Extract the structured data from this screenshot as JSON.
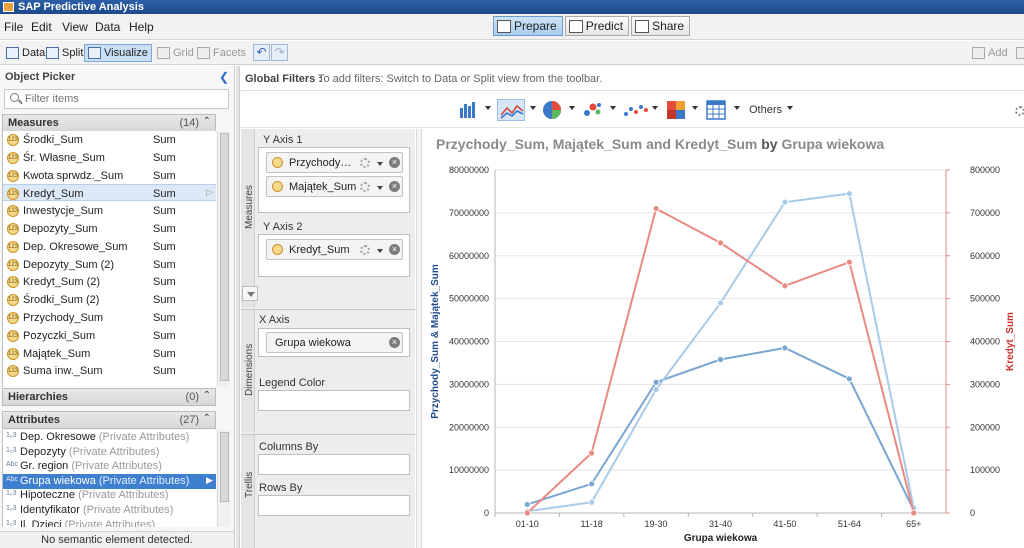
{
  "app": {
    "title": "SAP Predictive Analysis"
  },
  "menu": [
    "File",
    "Edit",
    "View",
    "Data",
    "Help"
  ],
  "modes": [
    {
      "label": "Prepare",
      "active": true,
      "icon": "prepare-icon"
    },
    {
      "label": "Predict",
      "active": false,
      "icon": "predict-icon"
    },
    {
      "label": "Share",
      "active": false,
      "icon": "share-icon"
    }
  ],
  "toolbar": {
    "data": "Data",
    "split": "Split",
    "visualize": "Visualize",
    "grid": "Grid",
    "facets": "Facets",
    "add": "Add"
  },
  "object_picker": {
    "title": "Object Picker",
    "search_placeholder": "Filter items",
    "measures": {
      "label": "Measures",
      "count": "(14)",
      "items": [
        {
          "name": "Środki_Sum",
          "agg": "Sum"
        },
        {
          "name": "Śr. Własne_Sum",
          "agg": "Sum"
        },
        {
          "name": "Kwota sprwdz._Sum",
          "agg": "Sum"
        },
        {
          "name": "Kredyt_Sum",
          "agg": "Sum",
          "selected": true
        },
        {
          "name": "Inwestycje_Sum",
          "agg": "Sum"
        },
        {
          "name": "Depozyty_Sum",
          "agg": "Sum"
        },
        {
          "name": "Dep. Okresowe_Sum",
          "agg": "Sum"
        },
        {
          "name": "Depozyty_Sum (2)",
          "agg": "Sum"
        },
        {
          "name": "Kredyt_Sum (2)",
          "agg": "Sum"
        },
        {
          "name": "Środki_Sum (2)",
          "agg": "Sum"
        },
        {
          "name": "Przychody_Sum",
          "agg": "Sum"
        },
        {
          "name": "Pozyczki_Sum",
          "agg": "Sum"
        },
        {
          "name": "Majątek_Sum",
          "agg": "Sum"
        },
        {
          "name": "Suma inw._Sum",
          "agg": "Sum"
        }
      ]
    },
    "hierarchies": {
      "label": "Hierarchies",
      "count": "(0)"
    },
    "attributes": {
      "label": "Attributes",
      "count": "(27)",
      "items": [
        {
          "name": "Dep. Okresowe",
          "meta": "(Private Attributes)",
          "icon": "1₂3"
        },
        {
          "name": "Depozyty",
          "meta": "(Private Attributes)",
          "icon": "1₂3"
        },
        {
          "name": "Gr. region",
          "meta": "(Private Attributes)",
          "icon": "Abc"
        },
        {
          "name": "Grupa wiekowa",
          "meta": "(Private Attributes)",
          "icon": "Abc",
          "selected": true
        },
        {
          "name": "Hipoteczne",
          "meta": "(Private Attributes)",
          "icon": "1₂3"
        },
        {
          "name": "Identyfikator",
          "meta": "(Private Attributes)",
          "icon": "1₂3"
        },
        {
          "name": "Il. Dzieci",
          "meta": "(Private Attributes)",
          "icon": "1₂3"
        }
      ]
    },
    "status": "No semantic element detected."
  },
  "global_filters": {
    "label": "Global Filters :",
    "hint": "To add filters: Switch to Data or Split view from the toolbar."
  },
  "chart_toolbar": {
    "others": "Others"
  },
  "feeders": {
    "measures_label": "Measures",
    "y_axis_1": {
      "label": "Y Axis 1",
      "chips": [
        "Przychody_S...",
        "Majątek_Sum"
      ]
    },
    "y_axis_2": {
      "label": "Y Axis 2",
      "chips": [
        "Kredyt_Sum"
      ]
    },
    "dimensions_label": "Dimensions",
    "x_axis": {
      "label": "X Axis",
      "chips": [
        "Grupa wiekowa"
      ]
    },
    "legend_color": "Legend Color",
    "trellis_label": "Trellis",
    "columns_by": "Columns By",
    "rows_by": "Rows By"
  },
  "chart_data": {
    "type": "line",
    "title": {
      "measures": "Przychody_Sum, Majątek_Sum and Kredyt_Sum",
      "by": "by",
      "dimension": "Grupa wiekowa"
    },
    "xlabel": "Grupa wiekowa",
    "ylabel": "Przychody_Sum & Majątek_Sum",
    "y2label": "Kredyt_Sum",
    "categories": [
      "01-10",
      "11-18",
      "19-30",
      "31-40",
      "41-50",
      "51-64",
      "65+"
    ],
    "ylim": [
      0,
      80000000
    ],
    "yticks": [
      0,
      10000000,
      20000000,
      30000000,
      40000000,
      50000000,
      60000000,
      70000000,
      80000000
    ],
    "y2lim": [
      0,
      800000
    ],
    "y2ticks": [
      0,
      100000,
      200000,
      300000,
      400000,
      500000,
      600000,
      700000,
      800000
    ],
    "grid": true,
    "colors": {
      "y1label": "#1f4e8c",
      "y2label": "#cc3333"
    },
    "series": [
      {
        "name": "Przychody_Sum",
        "axis": "y1",
        "color": "#7aa6d2",
        "values": [
          2000000,
          6800000,
          30500000,
          35800000,
          38500000,
          31300000,
          600000
        ]
      },
      {
        "name": "Majątek_Sum",
        "axis": "y1",
        "color": "#a8cbe8",
        "values": [
          400000,
          2500000,
          28800000,
          49000000,
          72500000,
          74500000,
          1200000
        ]
      },
      {
        "name": "Kredyt_Sum",
        "axis": "y2",
        "color": "#e98a80",
        "values": [
          0,
          140000,
          710000,
          630000,
          530000,
          585000,
          0
        ]
      }
    ]
  }
}
